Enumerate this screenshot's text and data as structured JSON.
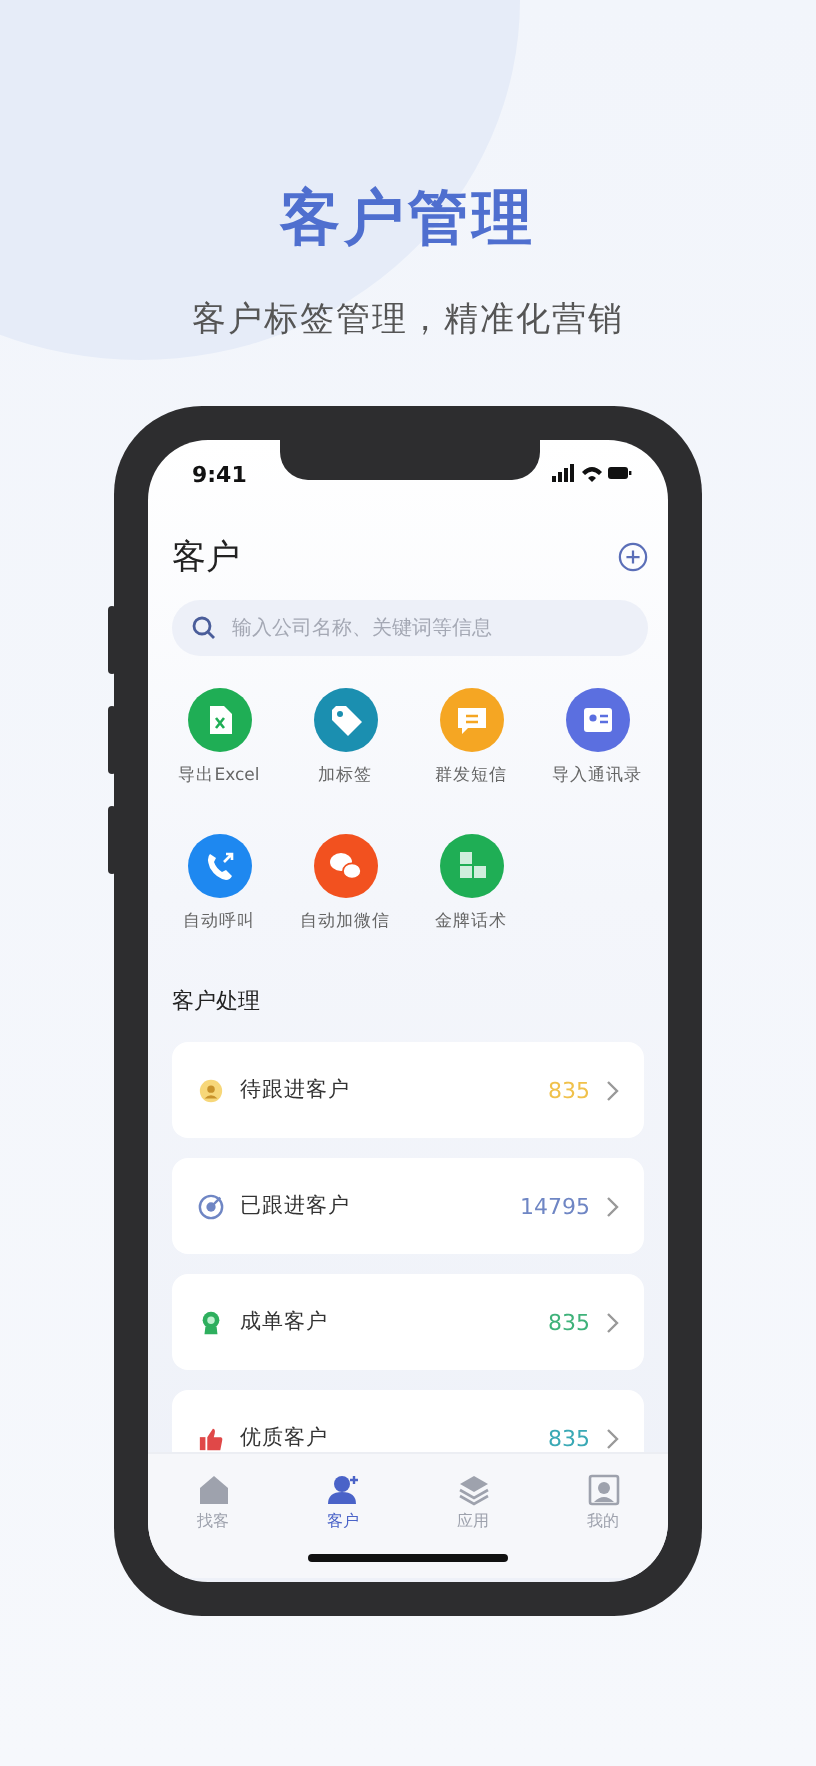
{
  "headline": {
    "title": "客户管理",
    "subtitle": "客户标签管理，精准化营销"
  },
  "status_bar": {
    "time": "9:41"
  },
  "header": {
    "title": "客户"
  },
  "search": {
    "placeholder": "输入公司名称、关键词等信息"
  },
  "actions": [
    {
      "kind": "excel",
      "label": "导出Excel",
      "color": "#1fae55"
    },
    {
      "kind": "tag",
      "label": "加标签",
      "color": "#1b8fb0"
    },
    {
      "kind": "sms",
      "label": "群发短信",
      "color": "#f5a623"
    },
    {
      "kind": "contacts",
      "label": "导入通讯录",
      "color": "#5b6fe0"
    },
    {
      "kind": "call",
      "label": "自动呼叫",
      "color": "#1e88f0"
    },
    {
      "kind": "wechat",
      "label": "自动加微信",
      "color": "#f2511f"
    },
    {
      "kind": "script",
      "label": "金牌话术",
      "color": "#1fae55"
    }
  ],
  "section": {
    "title": "客户处理"
  },
  "rows": [
    {
      "kind": "pending",
      "label": "待跟进客户",
      "count": "835",
      "color": "#f0c14b"
    },
    {
      "kind": "followed",
      "label": "已跟进客户",
      "count": "14795",
      "color": "#6f86c4"
    },
    {
      "kind": "closed",
      "label": "成单客户",
      "count": "835",
      "color": "#3fb27a"
    },
    {
      "kind": "quality",
      "label": "优质客户",
      "count": "835",
      "color": "#3aa9b5"
    }
  ],
  "tabs": [
    {
      "kind": "home",
      "label": "找客",
      "selected": false
    },
    {
      "kind": "customer",
      "label": "客户",
      "selected": true
    },
    {
      "kind": "apps",
      "label": "应用",
      "selected": false
    },
    {
      "kind": "mine",
      "label": "我的",
      "selected": false
    }
  ]
}
